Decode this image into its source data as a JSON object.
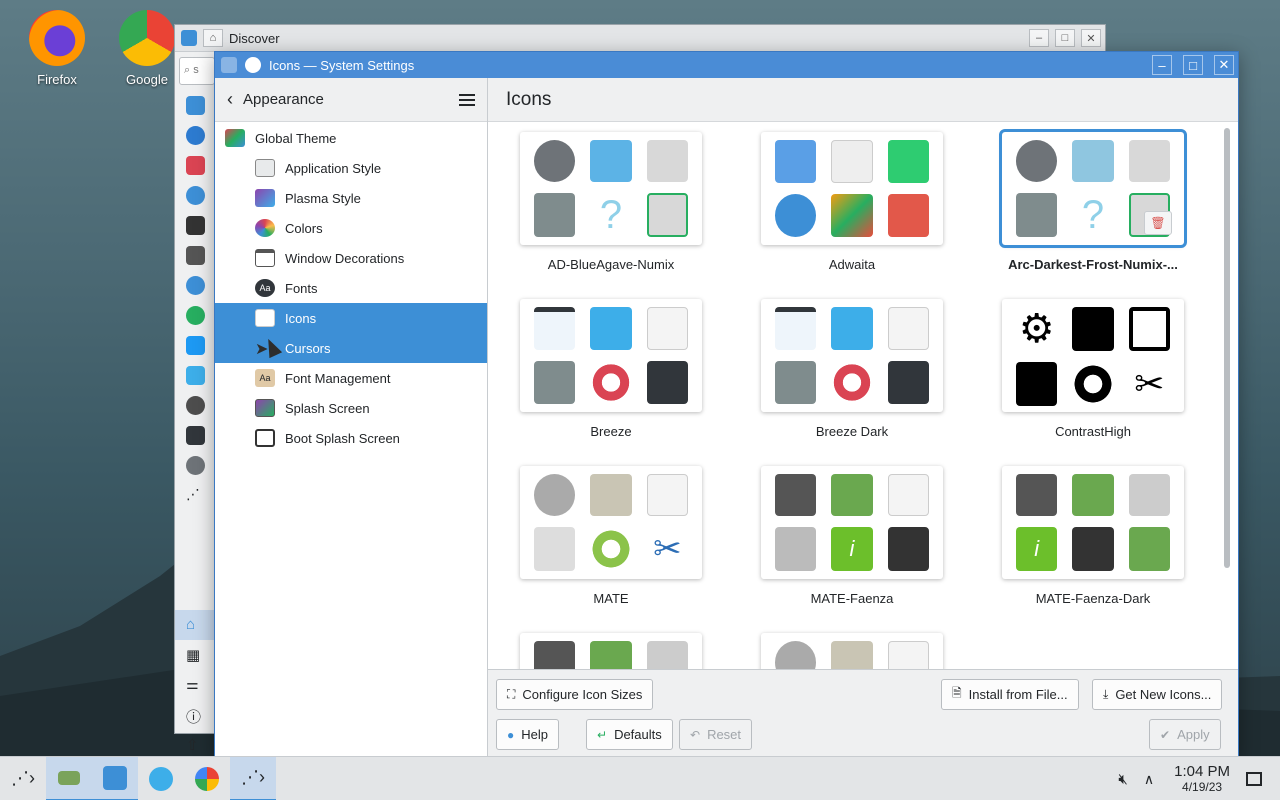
{
  "desktop": {
    "icons": [
      {
        "label": "Firefox"
      },
      {
        "label": "Google"
      }
    ]
  },
  "discover": {
    "title": "Discover",
    "search_placeholder": "s"
  },
  "settings": {
    "window_title": "Icons — System Settings",
    "nav_heading": "Appearance",
    "page_title": "Icons",
    "nav_items": [
      {
        "label": "Global Theme"
      },
      {
        "label": "Application Style"
      },
      {
        "label": "Plasma Style"
      },
      {
        "label": "Colors"
      },
      {
        "label": "Window Decorations"
      },
      {
        "label": "Fonts"
      },
      {
        "label": "Icons"
      },
      {
        "label": "Cursors"
      },
      {
        "label": "Font Management"
      },
      {
        "label": "Splash Screen"
      },
      {
        "label": "Boot Splash Screen"
      }
    ],
    "themes": [
      {
        "name": "AD-BlueAgave-Numix"
      },
      {
        "name": "Adwaita"
      },
      {
        "name": "Arc-Darkest-Frost-Numix-..."
      },
      {
        "name": "Breeze"
      },
      {
        "name": "Breeze Dark"
      },
      {
        "name": "ContrastHigh"
      },
      {
        "name": "MATE"
      },
      {
        "name": "MATE-Faenza"
      },
      {
        "name": "MATE-Faenza-Dark"
      }
    ],
    "buttons": {
      "configure_sizes": "Configure Icon Sizes",
      "install_from_file": "Install from File...",
      "get_new": "Get New Icons...",
      "help": "Help",
      "defaults": "Defaults",
      "reset": "Reset",
      "apply": "Apply"
    }
  },
  "taskbar": {
    "time": "1:04 PM",
    "date": "4/19/23"
  },
  "colors": {
    "accent": "#3d8fd6",
    "titlebar_active": "#4a8cd6"
  }
}
